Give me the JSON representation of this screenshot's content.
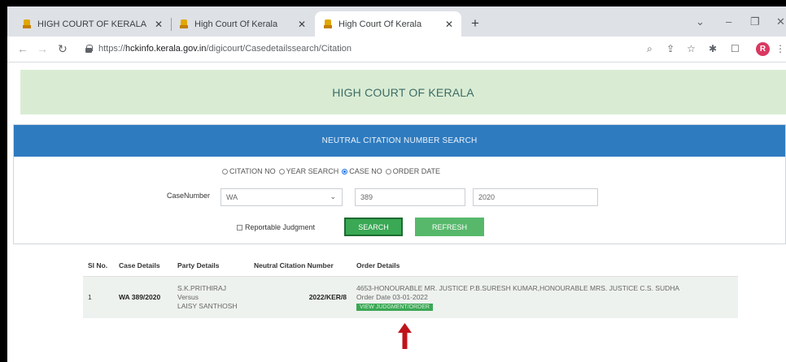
{
  "browser": {
    "tabs": [
      {
        "label": "HIGH COURT OF KERALA",
        "active": false
      },
      {
        "label": "High Court Of Kerala",
        "active": false
      },
      {
        "label": "High Court Of Kerala",
        "active": true
      }
    ],
    "new_tab_glyph": "+",
    "close_glyph": "✕",
    "url_scheme": "https://",
    "url_host": "hckinfo.kerala.gov.in",
    "url_path": "/digicourt/Casedetailssearch/Citation",
    "profile_initial": "R",
    "window_controls": [
      "⌄",
      "–",
      "❐",
      "✕"
    ]
  },
  "page": {
    "banner_title": "HIGH COURT OF KERALA",
    "panel_title": "NEUTRAL CITATION NUMBER SEARCH",
    "search_modes": [
      {
        "label": "CITATION NO",
        "selected": false
      },
      {
        "label": "YEAR SEARCH",
        "selected": false
      },
      {
        "label": "CASE NO",
        "selected": true
      },
      {
        "label": "ORDER DATE",
        "selected": false
      }
    ],
    "case_number_label": "CaseNumber",
    "case_type_value": "WA",
    "case_no_value": "389",
    "case_year_value": "2020",
    "reportable_label": "Reportable Judgment",
    "reportable_checked": false,
    "search_button": "SEARCH",
    "refresh_button": "REFRESH"
  },
  "results": {
    "columns": [
      "Sl No.",
      "Case Details",
      "Party Details",
      "Neutral Citation Number",
      "Order Details"
    ],
    "rows": [
      {
        "sl_no": "1",
        "case_details": "WA 389/2020",
        "party_lines": [
          "S.K.PRITHIRAJ",
          "Versus",
          "LAISY SANTHOSH"
        ],
        "citation": "2022/KER/8",
        "order_text": "4653-HONOURABLE MR. JUSTICE P.B.SURESH KUMAR,HONOURABLE MRS. JUSTICE C.S. SUDHA",
        "order_date": "Order Date 03-01-2022",
        "view_link": "VIEW JUDGMENT/ORDER"
      }
    ]
  },
  "colors": {
    "banner_bg": "#d9ecd3",
    "panel_header": "#2f7bbf",
    "button_green": "#3aa854",
    "annotation_arrow": "#c0141c"
  }
}
